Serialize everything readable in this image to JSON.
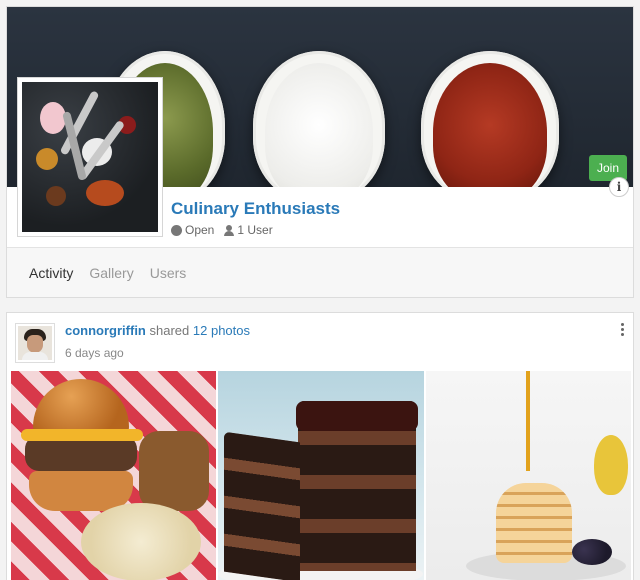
{
  "group": {
    "title": "Culinary Enthusiasts",
    "privacy": "Open",
    "members": "1 User",
    "join_label": "Join",
    "info_label": "i"
  },
  "tabs": [
    {
      "label": "Activity",
      "active": true
    },
    {
      "label": "Gallery",
      "active": false
    },
    {
      "label": "Users",
      "active": false
    }
  ],
  "post": {
    "author": "connorgriffin",
    "verb": "shared",
    "object": "12 photos",
    "time": "6 days ago"
  },
  "photos": [
    {
      "subject": "burger-photo"
    },
    {
      "subject": "cake-photo"
    },
    {
      "subject": "pancakes-photo"
    }
  ],
  "colors": {
    "link": "#2a7ab8",
    "join": "#4caf50"
  },
  "icons": {
    "privacy": "globe-icon",
    "members": "user-icon",
    "menu": "kebab-menu-icon",
    "info": "info-icon"
  }
}
